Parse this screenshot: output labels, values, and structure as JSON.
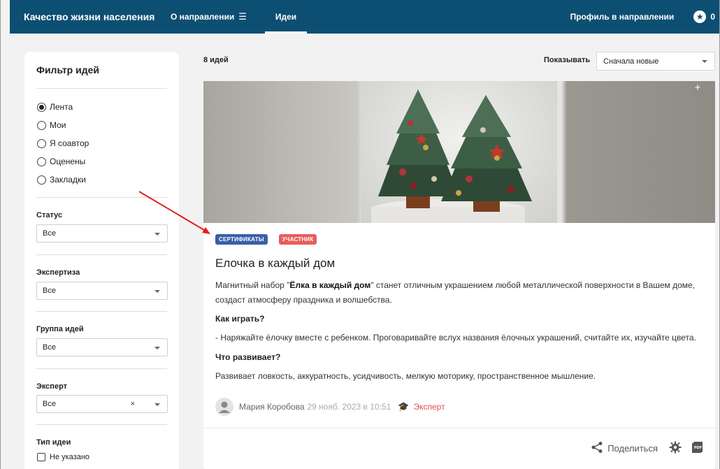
{
  "header": {
    "brand": "Качество жизни населения",
    "nav_about": "О направлении",
    "nav_ideas": "Идеи",
    "profile": "Профиль в направлении",
    "star_count": "0"
  },
  "sidebar": {
    "title": "Фильтр идей",
    "radio_options": [
      {
        "label": "Лента",
        "checked": true
      },
      {
        "label": "Мои",
        "checked": false
      },
      {
        "label": "Я соавтор",
        "checked": false
      },
      {
        "label": "Оценены",
        "checked": false
      },
      {
        "label": "Закладки",
        "checked": false
      }
    ],
    "status": {
      "label": "Статус",
      "value": "Все"
    },
    "expertise": {
      "label": "Экспертиза",
      "value": "Все"
    },
    "idea_group": {
      "label": "Группа идей",
      "value": "Все"
    },
    "expert": {
      "label": "Эксперт",
      "value": "Все",
      "clear": "×"
    },
    "idea_type": {
      "label": "Тип идеи",
      "option": "Не указано"
    }
  },
  "main": {
    "count": "8 идей",
    "show_label": "Показывать",
    "sort_value": "Сначала новые"
  },
  "card": {
    "tags": [
      "СЕРТИФИКАТЫ",
      "УЧАСТНИК"
    ],
    "title": "Елочка в каждый дом",
    "intro_prefix": "Магнитный набор \"",
    "intro_bold": "Ёлка в каждый дом",
    "intro_suffix_1": "\" станет отличным украшением любой металлической поверхности в Вашем доме,",
    "intro_suffix_2": "создаст атмосферу праздника и волшебства.",
    "q1": "Как играть?",
    "a1": "- Наряжайте ёлочку вместе с ребенком. Проговаривайте вслух названия ёлочных украшений, считайте их, изучайте цвета.",
    "q2": "Что развивает?",
    "a2": "Развивает ловкость, аккуратность, усидчивость, мелкую моторику, пространственное мышление.",
    "author": "Мария Коробова",
    "date": "29 нояб. 2023 в 10:51",
    "expert_label": "Эксперт",
    "share_label": "Поделиться"
  },
  "colors": {
    "header_bg": "#0d4f73",
    "tag_cert": "#3a5fa8",
    "tag_part": "#e85d5d",
    "expert": "#e84c4c",
    "arrow": "#e02020"
  },
  "icons": [
    "list-icon",
    "star-icon",
    "bookmark-icon",
    "avatar-icon",
    "expert-cap-icon",
    "share-icon",
    "gear-icon",
    "pdf-icon"
  ]
}
